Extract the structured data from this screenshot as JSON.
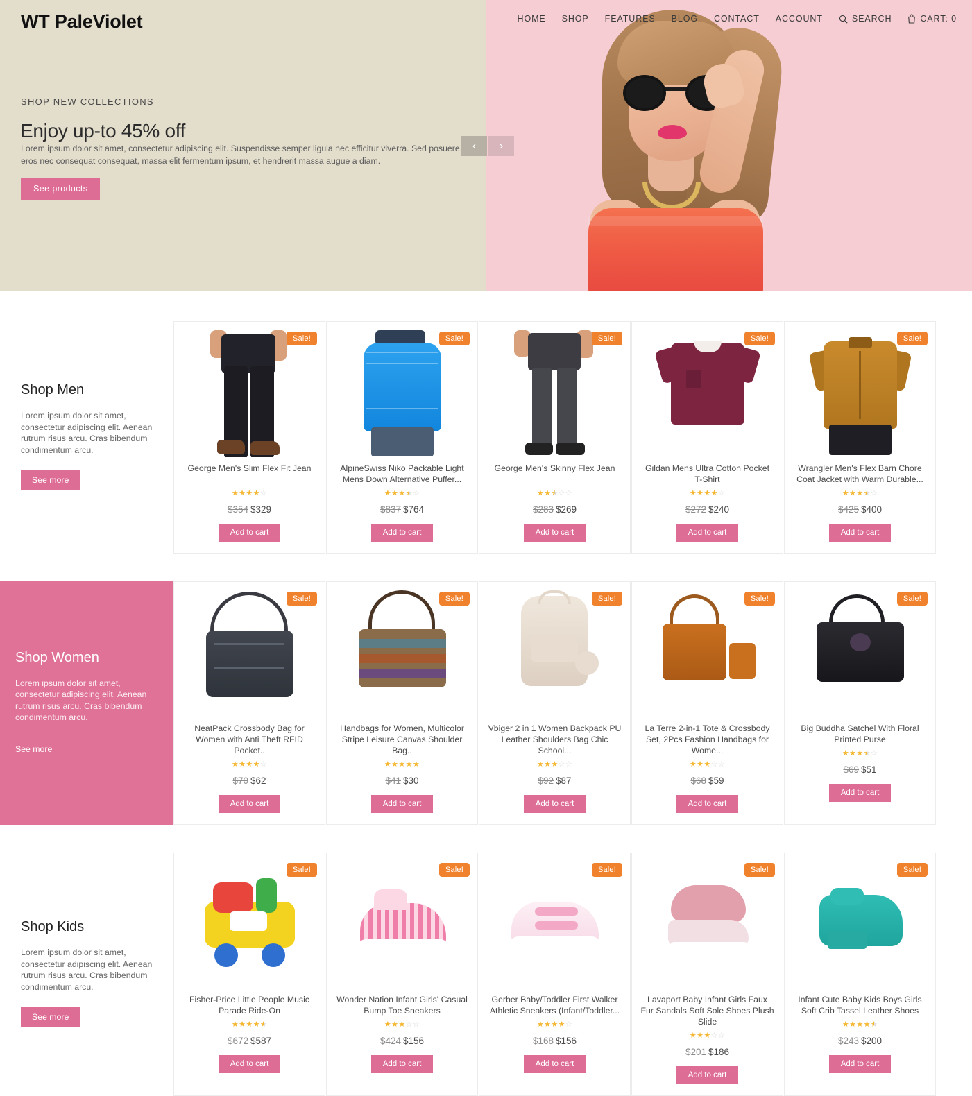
{
  "site": {
    "logo": "WT PaleViolet"
  },
  "nav": {
    "items": [
      {
        "label": "HOME",
        "name": "nav-home"
      },
      {
        "label": "SHOP",
        "name": "nav-shop"
      },
      {
        "label": "FEATURES",
        "name": "nav-features"
      },
      {
        "label": "BLOG",
        "name": "nav-blog"
      },
      {
        "label": "CONTACT",
        "name": "nav-contact"
      },
      {
        "label": "ACCOUNT",
        "name": "nav-account"
      }
    ],
    "search_label": "SEARCH",
    "cart_label": "CART: 0"
  },
  "hero": {
    "kicker": "SHOP NEW COLLECTIONS",
    "title": "Enjoy up-to 45% off",
    "description": "Lorem ipsum dolor sit amet, consectetur adipiscing elit. Suspendisse semper ligula nec efficitur viverra. Sed posuere, eros nec consequat consequat, massa elit fermentum ipsum, et hendrerit massa augue a diam.",
    "cta": "See products",
    "prev_arrow": "‹",
    "next_arrow": "›",
    "bg_left": "#e3ddcc",
    "bg_right": "#f6cdd3"
  },
  "colors": {
    "accent_pink": "#de6d95",
    "sale_orange": "#f0822d",
    "star_gold": "#f5b731",
    "star_off": "#dadada"
  },
  "labels": {
    "add_to_cart": "Add to cart",
    "see_more": "See more",
    "sale": "Sale!"
  },
  "sections": [
    {
      "id": "men",
      "title": "Shop Men",
      "description": "Lorem ipsum dolor sit amet, consectetur adipiscing elit. Aenean rutrum risus arcu. Cras bibendum condimentum arcu.",
      "cta": "See more",
      "products": [
        {
          "title": "George Men's Slim Flex Fit Jean",
          "rating": 4,
          "old_price": "$354",
          "new_price": "$329",
          "sale": "Sale!",
          "cta": "Add to cart"
        },
        {
          "title": "AlpineSwiss Niko Packable Light Mens Down Alternative Puffer...",
          "rating": 3.5,
          "old_price": "$837",
          "new_price": "$764",
          "sale": "Sale!",
          "cta": "Add to cart"
        },
        {
          "title": "George Men's Skinny Flex Jean",
          "rating": 2.5,
          "old_price": "$283",
          "new_price": "$269",
          "sale": "Sale!",
          "cta": "Add to cart"
        },
        {
          "title": "Gildan Mens Ultra Cotton Pocket T-Shirt",
          "rating": 4,
          "old_price": "$272",
          "new_price": "$240",
          "sale": "Sale!",
          "cta": "Add to cart"
        },
        {
          "title": "Wrangler Men's Flex Barn Chore Coat Jacket with Warm Durable...",
          "rating": 3.5,
          "old_price": "$425",
          "new_price": "$400",
          "sale": "Sale!",
          "cta": "Add to cart"
        }
      ]
    },
    {
      "id": "women",
      "title": "Shop Women",
      "description": "Lorem ipsum dolor sit amet, consectetur adipiscing elit. Aenean rutrum risus arcu. Cras bibendum condimentum arcu.",
      "cta": "See more",
      "products": [
        {
          "title": "NeatPack Crossbody Bag for Women with Anti Theft RFID Pocket..",
          "rating": 4,
          "old_price": "$70",
          "new_price": "$62",
          "sale": "Sale!",
          "cta": "Add to cart"
        },
        {
          "title": "Handbags for Women, Multicolor Stripe Leisure Canvas Shoulder Bag..",
          "rating": 5,
          "old_price": "$41",
          "new_price": "$30",
          "sale": "Sale!",
          "cta": "Add to cart"
        },
        {
          "title": "Vbiger 2 in 1 Women Backpack PU Leather Shoulders Bag Chic School...",
          "rating": 3,
          "old_price": "$92",
          "new_price": "$87",
          "sale": "Sale!",
          "cta": "Add to cart"
        },
        {
          "title": "La Terre 2-in-1 Tote & Crossbody Set, 2Pcs Fashion Handbags for Wome...",
          "rating": 3,
          "old_price": "$68",
          "new_price": "$59",
          "sale": "Sale!",
          "cta": "Add to cart"
        },
        {
          "title": "Big Buddha Satchel With Floral Printed Purse",
          "rating": 3.5,
          "old_price": "$69",
          "new_price": "$51",
          "sale": "Sale!",
          "cta": "Add to cart"
        }
      ]
    },
    {
      "id": "kids",
      "title": "Shop Kids",
      "description": "Lorem ipsum dolor sit amet, consectetur adipiscing elit. Aenean rutrum risus arcu. Cras bibendum condimentum arcu.",
      "cta": "See more",
      "products": [
        {
          "title": "Fisher-Price Little People Music Parade Ride-On",
          "rating": 4.5,
          "old_price": "$672",
          "new_price": "$587",
          "sale": "Sale!",
          "cta": "Add to cart"
        },
        {
          "title": "Wonder Nation Infant Girls' Casual Bump Toe Sneakers",
          "rating": 3,
          "old_price": "$424",
          "new_price": "$156",
          "sale": "Sale!",
          "cta": "Add to cart"
        },
        {
          "title": "Gerber Baby/Toddler First Walker Athletic Sneakers (Infant/Toddler...",
          "rating": 4,
          "old_price": "$168",
          "new_price": "$156",
          "sale": "Sale!",
          "cta": "Add to cart"
        },
        {
          "title": "Lavaport Baby Infant Girls Faux Fur Sandals Soft Sole Shoes Plush Slide",
          "rating": 3,
          "old_price": "$201",
          "new_price": "$186",
          "sale": "Sale!",
          "cta": "Add to cart"
        },
        {
          "title": "Infant Cute Baby Kids Boys Girls Soft Crib Tassel Leather Shoes",
          "rating": 4.5,
          "old_price": "$243",
          "new_price": "$200",
          "sale": "Sale!",
          "cta": "Add to cart"
        }
      ]
    }
  ]
}
